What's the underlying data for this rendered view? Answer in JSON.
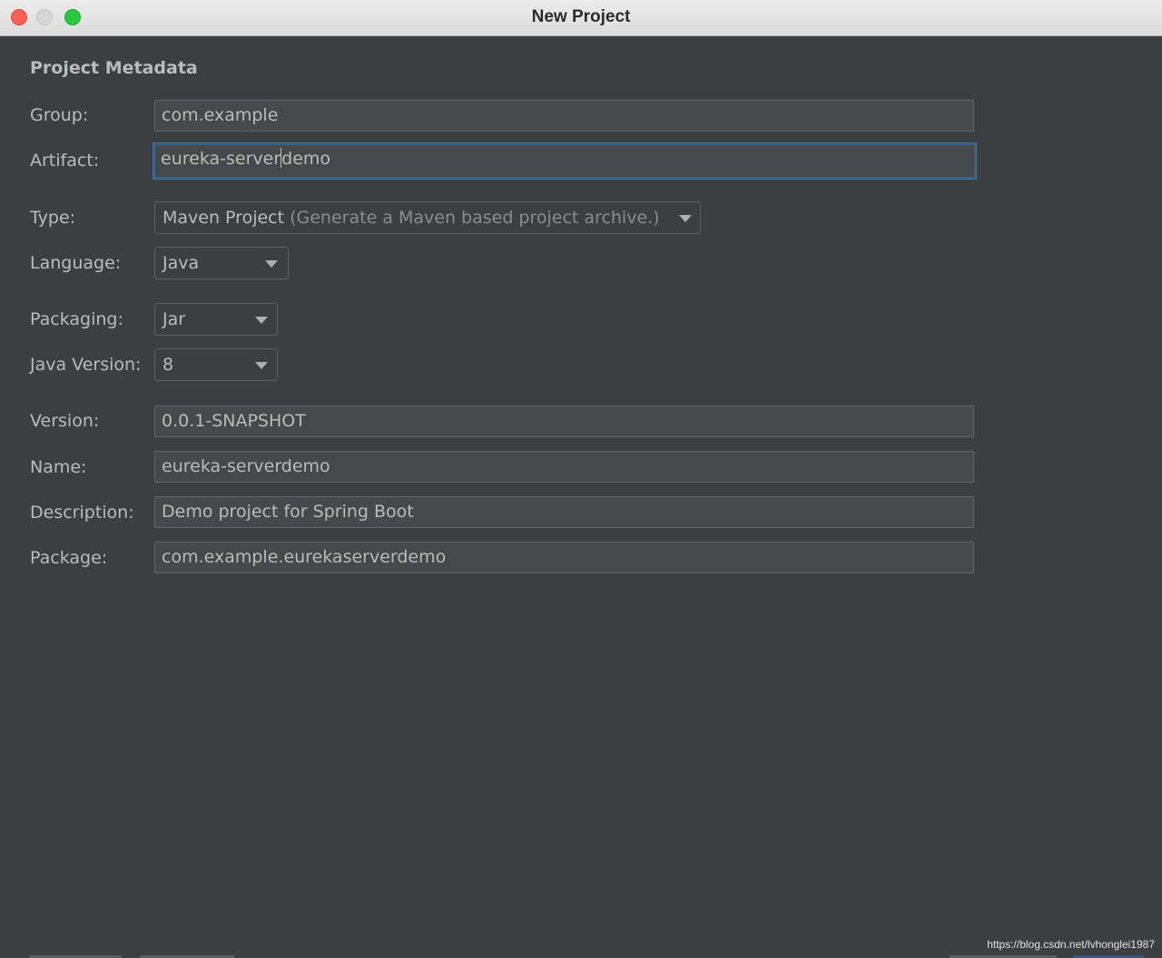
{
  "window": {
    "title": "New Project"
  },
  "section": {
    "title": "Project Metadata"
  },
  "form": {
    "group": {
      "label": "Group:",
      "value": "com.example"
    },
    "artifact": {
      "label": "Artifact:",
      "value_before_caret": "eureka-server",
      "value_after_caret": "demo"
    },
    "type": {
      "label": "Type:",
      "value": "Maven Project",
      "hint": " (Generate a Maven based project archive.)"
    },
    "language": {
      "label": "Language:",
      "value": "Java"
    },
    "packaging": {
      "label": "Packaging:",
      "value": "Jar"
    },
    "java_version": {
      "label": "Java Version:",
      "value": "8"
    },
    "version": {
      "label": "Version:",
      "value": "0.0.1-SNAPSHOT"
    },
    "name": {
      "label": "Name:",
      "value": "eureka-serverdemo"
    },
    "description": {
      "label": "Description:",
      "value": "Demo project for Spring Boot"
    },
    "package": {
      "label": "Package:",
      "value": "com.example.eurekaserverdemo"
    }
  },
  "watermark": "https://blog.csdn.net/lvhonglei1987"
}
